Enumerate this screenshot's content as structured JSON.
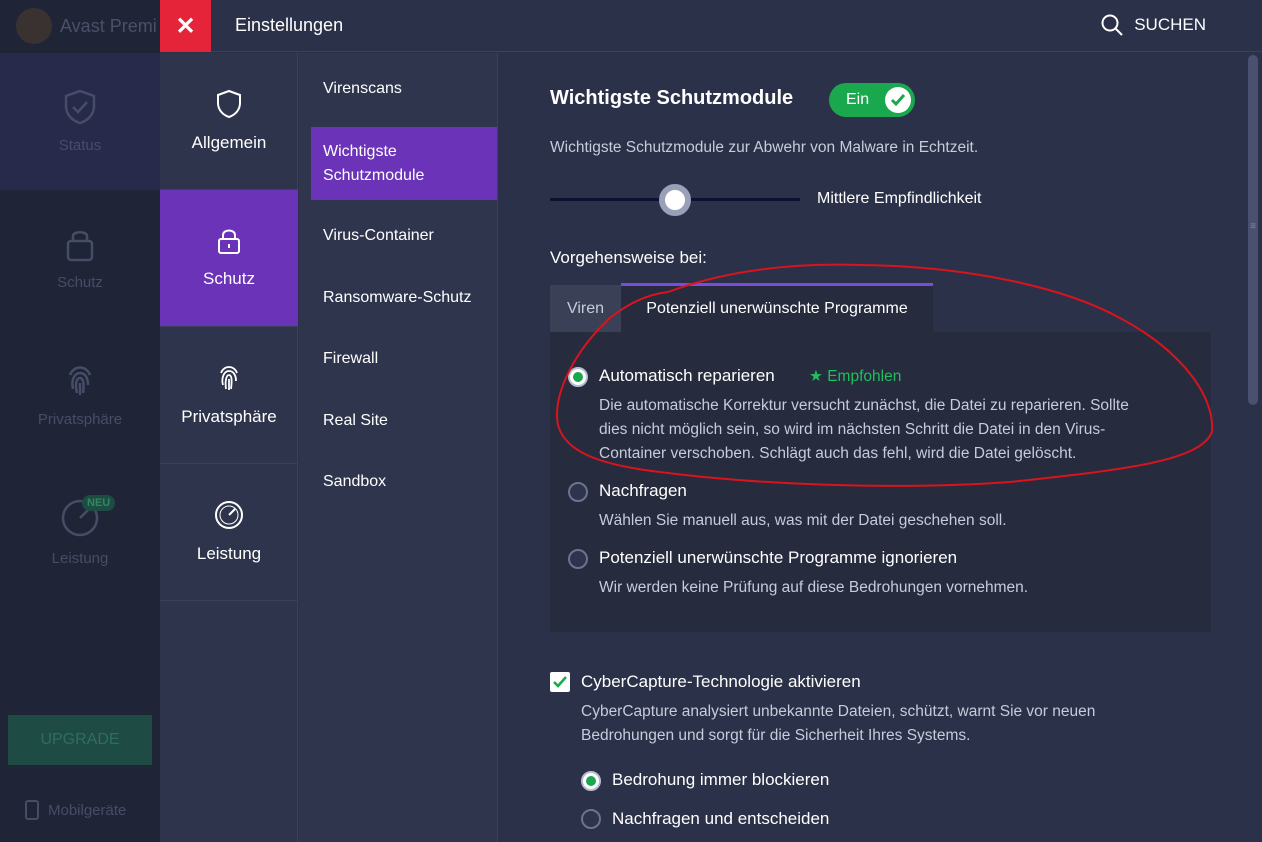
{
  "background": {
    "app_title": "Avast Premi",
    "nav": [
      "Status",
      "Schutz",
      "Privatsphäre",
      "Leistung"
    ],
    "neu_badge": "NEU",
    "upgrade": "UPGRADE",
    "mobile": "Mobilgeräte"
  },
  "header": {
    "close": "✕",
    "title": "Einstellungen",
    "search": "SUCHEN"
  },
  "categories": [
    {
      "label": "Allgemein",
      "icon": "shield-icon"
    },
    {
      "label": "Schutz",
      "icon": "lock-icon",
      "active": true
    },
    {
      "label": "Privatsphäre",
      "icon": "fingerprint-icon"
    },
    {
      "label": "Leistung",
      "icon": "speedometer-icon"
    }
  ],
  "subnav": [
    "Virenscans",
    "Wichtigste Schutzmodule",
    "Virus-Container",
    "Ransomware-Schutz",
    "Firewall",
    "Real Site",
    "Sandbox"
  ],
  "main": {
    "title": "Wichtigste Schutzmodule",
    "toggle": "Ein",
    "description": "Wichtigste Schutzmodule zur Abwehr von Malware in Echtzeit.",
    "sensitivity": "Mittlere Empfindlichkeit",
    "procedure_label": "Vorgehensweise bei:",
    "tabs": [
      "Viren",
      "Potenziell unerwünschte Programme"
    ],
    "options": [
      {
        "title": "Automatisch reparieren",
        "recommended": "Empfohlen",
        "desc_lines": [
          "Die automatische Korrektur versucht zunächst, die Datei zu reparieren. Sollte",
          "dies nicht möglich sein, so wird im nächsten Schritt die Datei in den Virus-",
          "Container verschoben. Schlägt auch das fehl, wird die Datei gelöscht."
        ]
      },
      {
        "title": "Nachfragen",
        "desc_lines": [
          "Wählen Sie manuell aus, was mit der Datei geschehen soll."
        ]
      },
      {
        "title": "Potenziell unerwünschte Programme ignorieren",
        "desc_lines": [
          "Wir werden keine Prüfung auf diese Bedrohungen vornehmen."
        ]
      }
    ],
    "cybercapture": {
      "title": "CyberCapture-Technologie aktivieren",
      "desc_lines": [
        "CyberCapture analysiert unbekannte Dateien, schützt, warnt Sie vor neuen",
        "Bedrohungen und sorgt für die Sicherheit Ihres Systems."
      ],
      "options": [
        "Bedrohung immer blockieren",
        "Nachfragen und entscheiden"
      ]
    }
  },
  "colors": {
    "accent_purple": "#6a33b8",
    "close_red": "#e5243a",
    "toggle_green": "#1aa84e",
    "annotation_red": "#d8141e"
  }
}
